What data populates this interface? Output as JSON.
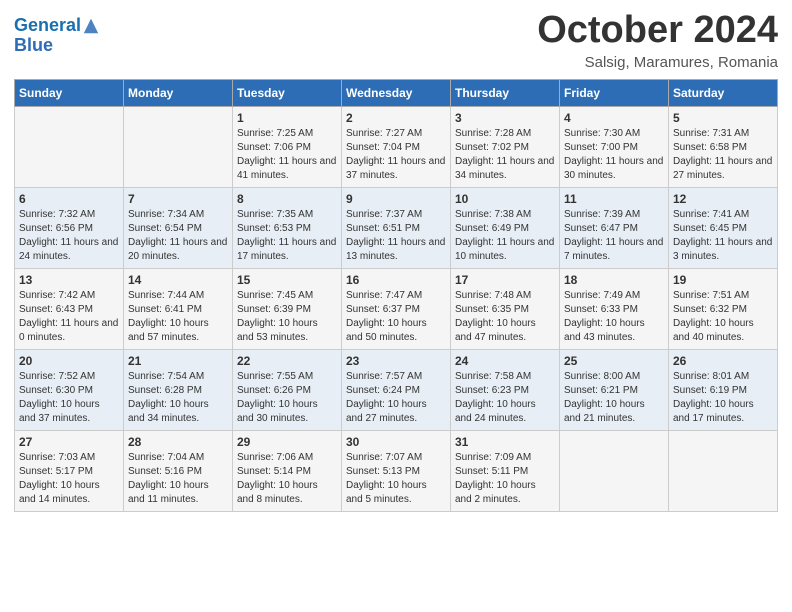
{
  "header": {
    "logo_line1": "General",
    "logo_line2": "Blue",
    "month": "October 2024",
    "location": "Salsig, Maramures, Romania"
  },
  "weekdays": [
    "Sunday",
    "Monday",
    "Tuesday",
    "Wednesday",
    "Thursday",
    "Friday",
    "Saturday"
  ],
  "weeks": [
    [
      {
        "day": "",
        "sunrise": "",
        "sunset": "",
        "daylight": ""
      },
      {
        "day": "",
        "sunrise": "",
        "sunset": "",
        "daylight": ""
      },
      {
        "day": "1",
        "sunrise": "Sunrise: 7:25 AM",
        "sunset": "Sunset: 7:06 PM",
        "daylight": "Daylight: 11 hours and 41 minutes."
      },
      {
        "day": "2",
        "sunrise": "Sunrise: 7:27 AM",
        "sunset": "Sunset: 7:04 PM",
        "daylight": "Daylight: 11 hours and 37 minutes."
      },
      {
        "day": "3",
        "sunrise": "Sunrise: 7:28 AM",
        "sunset": "Sunset: 7:02 PM",
        "daylight": "Daylight: 11 hours and 34 minutes."
      },
      {
        "day": "4",
        "sunrise": "Sunrise: 7:30 AM",
        "sunset": "Sunset: 7:00 PM",
        "daylight": "Daylight: 11 hours and 30 minutes."
      },
      {
        "day": "5",
        "sunrise": "Sunrise: 7:31 AM",
        "sunset": "Sunset: 6:58 PM",
        "daylight": "Daylight: 11 hours and 27 minutes."
      }
    ],
    [
      {
        "day": "6",
        "sunrise": "Sunrise: 7:32 AM",
        "sunset": "Sunset: 6:56 PM",
        "daylight": "Daylight: 11 hours and 24 minutes."
      },
      {
        "day": "7",
        "sunrise": "Sunrise: 7:34 AM",
        "sunset": "Sunset: 6:54 PM",
        "daylight": "Daylight: 11 hours and 20 minutes."
      },
      {
        "day": "8",
        "sunrise": "Sunrise: 7:35 AM",
        "sunset": "Sunset: 6:53 PM",
        "daylight": "Daylight: 11 hours and 17 minutes."
      },
      {
        "day": "9",
        "sunrise": "Sunrise: 7:37 AM",
        "sunset": "Sunset: 6:51 PM",
        "daylight": "Daylight: 11 hours and 13 minutes."
      },
      {
        "day": "10",
        "sunrise": "Sunrise: 7:38 AM",
        "sunset": "Sunset: 6:49 PM",
        "daylight": "Daylight: 11 hours and 10 minutes."
      },
      {
        "day": "11",
        "sunrise": "Sunrise: 7:39 AM",
        "sunset": "Sunset: 6:47 PM",
        "daylight": "Daylight: 11 hours and 7 minutes."
      },
      {
        "day": "12",
        "sunrise": "Sunrise: 7:41 AM",
        "sunset": "Sunset: 6:45 PM",
        "daylight": "Daylight: 11 hours and 3 minutes."
      }
    ],
    [
      {
        "day": "13",
        "sunrise": "Sunrise: 7:42 AM",
        "sunset": "Sunset: 6:43 PM",
        "daylight": "Daylight: 11 hours and 0 minutes."
      },
      {
        "day": "14",
        "sunrise": "Sunrise: 7:44 AM",
        "sunset": "Sunset: 6:41 PM",
        "daylight": "Daylight: 10 hours and 57 minutes."
      },
      {
        "day": "15",
        "sunrise": "Sunrise: 7:45 AM",
        "sunset": "Sunset: 6:39 PM",
        "daylight": "Daylight: 10 hours and 53 minutes."
      },
      {
        "day": "16",
        "sunrise": "Sunrise: 7:47 AM",
        "sunset": "Sunset: 6:37 PM",
        "daylight": "Daylight: 10 hours and 50 minutes."
      },
      {
        "day": "17",
        "sunrise": "Sunrise: 7:48 AM",
        "sunset": "Sunset: 6:35 PM",
        "daylight": "Daylight: 10 hours and 47 minutes."
      },
      {
        "day": "18",
        "sunrise": "Sunrise: 7:49 AM",
        "sunset": "Sunset: 6:33 PM",
        "daylight": "Daylight: 10 hours and 43 minutes."
      },
      {
        "day": "19",
        "sunrise": "Sunrise: 7:51 AM",
        "sunset": "Sunset: 6:32 PM",
        "daylight": "Daylight: 10 hours and 40 minutes."
      }
    ],
    [
      {
        "day": "20",
        "sunrise": "Sunrise: 7:52 AM",
        "sunset": "Sunset: 6:30 PM",
        "daylight": "Daylight: 10 hours and 37 minutes."
      },
      {
        "day": "21",
        "sunrise": "Sunrise: 7:54 AM",
        "sunset": "Sunset: 6:28 PM",
        "daylight": "Daylight: 10 hours and 34 minutes."
      },
      {
        "day": "22",
        "sunrise": "Sunrise: 7:55 AM",
        "sunset": "Sunset: 6:26 PM",
        "daylight": "Daylight: 10 hours and 30 minutes."
      },
      {
        "day": "23",
        "sunrise": "Sunrise: 7:57 AM",
        "sunset": "Sunset: 6:24 PM",
        "daylight": "Daylight: 10 hours and 27 minutes."
      },
      {
        "day": "24",
        "sunrise": "Sunrise: 7:58 AM",
        "sunset": "Sunset: 6:23 PM",
        "daylight": "Daylight: 10 hours and 24 minutes."
      },
      {
        "day": "25",
        "sunrise": "Sunrise: 8:00 AM",
        "sunset": "Sunset: 6:21 PM",
        "daylight": "Daylight: 10 hours and 21 minutes."
      },
      {
        "day": "26",
        "sunrise": "Sunrise: 8:01 AM",
        "sunset": "Sunset: 6:19 PM",
        "daylight": "Daylight: 10 hours and 17 minutes."
      }
    ],
    [
      {
        "day": "27",
        "sunrise": "Sunrise: 7:03 AM",
        "sunset": "Sunset: 5:17 PM",
        "daylight": "Daylight: 10 hours and 14 minutes."
      },
      {
        "day": "28",
        "sunrise": "Sunrise: 7:04 AM",
        "sunset": "Sunset: 5:16 PM",
        "daylight": "Daylight: 10 hours and 11 minutes."
      },
      {
        "day": "29",
        "sunrise": "Sunrise: 7:06 AM",
        "sunset": "Sunset: 5:14 PM",
        "daylight": "Daylight: 10 hours and 8 minutes."
      },
      {
        "day": "30",
        "sunrise": "Sunrise: 7:07 AM",
        "sunset": "Sunset: 5:13 PM",
        "daylight": "Daylight: 10 hours and 5 minutes."
      },
      {
        "day": "31",
        "sunrise": "Sunrise: 7:09 AM",
        "sunset": "Sunset: 5:11 PM",
        "daylight": "Daylight: 10 hours and 2 minutes."
      },
      {
        "day": "",
        "sunrise": "",
        "sunset": "",
        "daylight": ""
      },
      {
        "day": "",
        "sunrise": "",
        "sunset": "",
        "daylight": ""
      }
    ]
  ]
}
